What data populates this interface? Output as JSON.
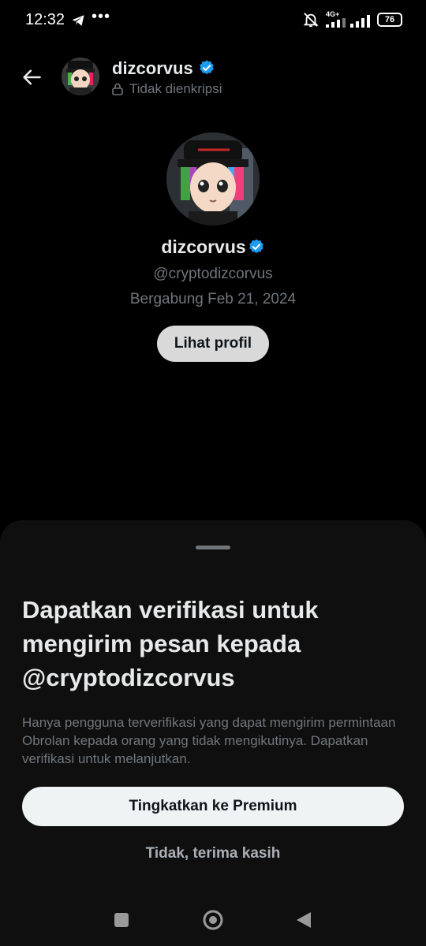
{
  "status_bar": {
    "time": "12:32",
    "dots": "•••",
    "network": "4G+",
    "battery": "76"
  },
  "header": {
    "name": "dizcorvus",
    "encryption_status": "Tidak dienkripsi"
  },
  "profile": {
    "name": "dizcorvus",
    "handle": "@cryptodizcorvus",
    "joined": "Bergabung Feb 21, 2024",
    "view_profile_label": "Lihat profil"
  },
  "sheet": {
    "title": "Dapatkan verifikasi untuk mengirim pesan kepada @cryptodizcorvus",
    "description": "Hanya pengguna terverifikasi yang dapat mengirim permintaan Obrolan kepada orang yang tidak mengikutinya. Dapatkan verifikasi untuk melanjutkan.",
    "upgrade_label": "Tingkatkan ke Premium",
    "decline_label": "Tidak, terima kasih"
  },
  "colors": {
    "verified": "#1d9bf0",
    "background": "#000000",
    "sheet": "#0f0f0f",
    "muted_text": "#71767b"
  },
  "icons": [
    "telegram-icon",
    "mute-icon",
    "signal-icon",
    "battery-icon",
    "back-arrow-icon",
    "verified-icon",
    "lock-icon",
    "recents-icon",
    "home-icon",
    "nav-back-icon"
  ]
}
